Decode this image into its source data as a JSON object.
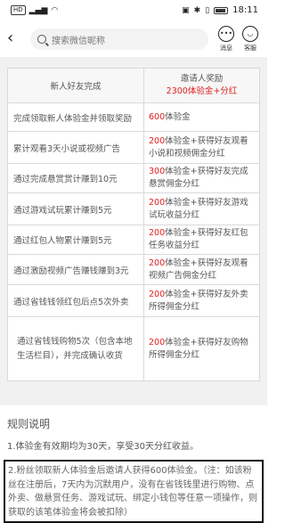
{
  "status_bar": {
    "left_badge": "HD",
    "time": "18:11"
  },
  "header": {
    "search_placeholder": "搜索微信昵称",
    "message_label": "消息",
    "service_label": "客服"
  },
  "table": {
    "header": {
      "col1": "新人好友完成",
      "col2_line1": "邀请人奖励",
      "col2_line2": "2300体验金+分红"
    },
    "rows": [
      {
        "task": "完成领取新人体验金并领取奖励",
        "reward_red": "600",
        "reward_rest": "体验金"
      },
      {
        "task": "累计观看3天小说或视频广告",
        "reward_red": "200",
        "reward_rest": "体验金+获得好友观看小说和视频佣金分红"
      },
      {
        "task": "通过完成悬赏赏计赚到10元",
        "reward_red": "300",
        "reward_rest": "体验金+获得好友完成悬赏佣金分红"
      },
      {
        "task": "通过游戏试玩累计赚到5元",
        "reward_red": "200",
        "reward_rest": "体验金+获得好友游戏试玩收益分红"
      },
      {
        "task": "通过红包人物累计赚到5元",
        "reward_red": "200",
        "reward_rest": "体验金+获得好友红包任务收益分红"
      },
      {
        "task": "通过激励视频广告赚钱赚到3元",
        "reward_red": "200",
        "reward_rest": "体验金+获得好友观看视频广告佣金分红"
      },
      {
        "task": "通过省钱钱领红包后点5次外卖",
        "reward_red": "200",
        "reward_rest": "体验金+获得好友外卖所得佣金分红"
      },
      {
        "task": "通过省钱钱购物5次（包含本地生活栏目），并完成确认收货",
        "reward_red": "200",
        "reward_rest": "体验金+获得好友购物所得佣金分红"
      }
    ]
  },
  "rules": {
    "title": "规则说明",
    "item1": "1.体验金有效期均为30天，享受30天分红收益。",
    "item2": "2.粉丝领取新人体验金后邀请人获得600体验金。（注：如该粉丝在注册后，7天内为沉默用户，没有在省钱钱里进行购物、点外卖、做悬赏任务、游戏试玩、绑定小钱包等任意一项操作，则获取的该笔体验金将会被扣除）"
  }
}
